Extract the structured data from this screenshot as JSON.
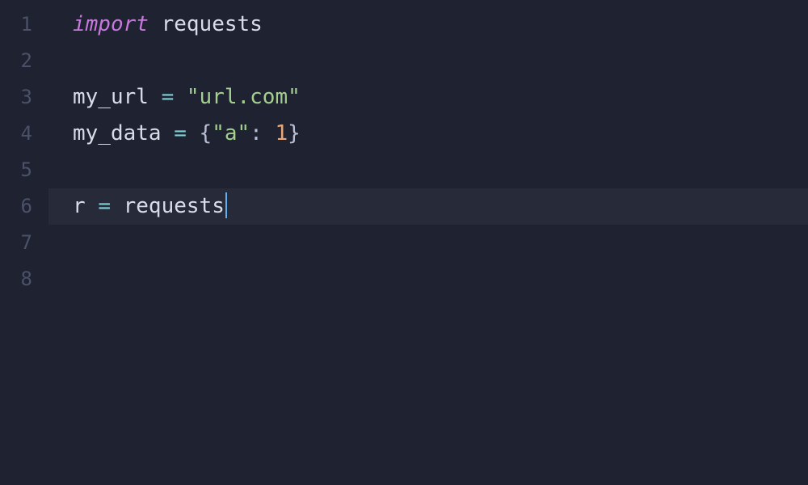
{
  "editor": {
    "lines": [
      {
        "num": "1",
        "current": false
      },
      {
        "num": "2",
        "current": false
      },
      {
        "num": "3",
        "current": false
      },
      {
        "num": "4",
        "current": false
      },
      {
        "num": "5",
        "current": false
      },
      {
        "num": "6",
        "current": true
      },
      {
        "num": "7",
        "current": false
      },
      {
        "num": "8",
        "current": false
      }
    ],
    "tokens": {
      "l1": {
        "t0": "import",
        "t1": " requests"
      },
      "l3": {
        "t0": "my_url ",
        "t1": "=",
        "t2": " ",
        "t3": "\"url.com\""
      },
      "l4": {
        "t0": "my_data ",
        "t1": "=",
        "t2": " ",
        "t3": "{",
        "t4": "\"a\"",
        "t5": ":",
        "t6": " ",
        "t7": "1",
        "t8": "}"
      },
      "l6": {
        "t0": "r ",
        "t1": "=",
        "t2": " requests"
      }
    }
  }
}
